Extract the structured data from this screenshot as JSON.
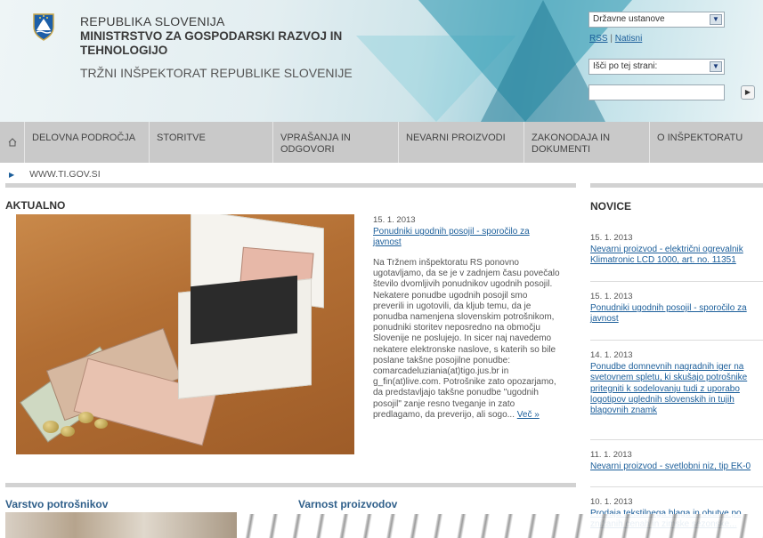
{
  "header": {
    "gov_line1": "REPUBLIKA SLOVENIJA",
    "ministry": "MINISTRSTVO ZA GOSPODARSKI RAZVOJ IN TEHNOLOGIJO",
    "inspectorate": "TRŽNI INŠPEKTORAT REPUBLIKE SLOVENIJE",
    "institutions_select": "Državne ustanove",
    "rss": "RSS",
    "print": "Natisni",
    "search_scope_select": "Išči po tej strani:",
    "search_value": ""
  },
  "nav": {
    "items": [
      {
        "label": "DELOVNA PODROČJA"
      },
      {
        "label": "STORITVE"
      },
      {
        "label": "VPRAŠANJA IN ODGOVORI"
      },
      {
        "label": "NEVARNI PROIZVODI"
      },
      {
        "label": "ZAKONODAJA IN DOKUMENTI"
      },
      {
        "label": "O INŠPEKTORATU"
      }
    ]
  },
  "breadcrumb": "WWW.TI.GOV.SI",
  "aktualno": {
    "heading": "AKTUALNO",
    "date": "15. 1. 2013",
    "title": "Ponudniki ugodnih posojil - sporočilo za javnost",
    "body": " Na Tržnem inšpektoratu RS ponovno ugotavljamo, da se je v zadnjem času povečalo število dvomljivih ponudnikov ugodnih posojil. Nekatere ponudbe ugodnih posojil smo preverili in ugotovili, da kljub temu, da je ponudba namenjena slovenskim potrošnikom, ponudniki storitev neposredno na območju Slovenije ne poslujejo. In sicer naj navedemo nekatere elektronske naslove, s katerih so bile poslane takšne posojilne ponudbe: comarcadeluziania(at)tigo.jus.br in g_fin(at)live.com.   Potrošnike zato opozarjamo, da predstavljajo takšne ponudbe \"ugodnih posojil\" zanje resno tveganje in zato predlagamo, da preverijo, ali sogo... ",
    "more": "Več »"
  },
  "novice": {
    "heading": "NOVICE",
    "items": [
      {
        "date": "15. 1. 2013",
        "title": "Nevarni proizvod - električni ogrevalnik Klimatronic LCD 1000, art. no. 11351"
      },
      {
        "date": "15. 1. 2013",
        "title": "Ponudniki ugodnih posojil - sporočilo za javnost"
      },
      {
        "date": "14. 1. 2013",
        "title": "Ponudbe domnevnih nagradnih iger na svetovnem spletu, ki skušajo potrošnike pritegniti k sodelovanju tudi z uporabo logotipov uglednih slovenskih in tujih blagovnih znamk"
      },
      {
        "date": "11. 1. 2013",
        "title": "Nevarni proizvod - svetlobni niz, tip EK-0"
      },
      {
        "date": "10. 1. 2013",
        "title": "Prodaja tekstilnega blaga in obutve po znižanih cenah in zimske sezonske..."
      }
    ]
  },
  "sections": {
    "consumer_protection": "Varstvo potrošnikov",
    "product_safety": "Varnost proizvodov"
  }
}
